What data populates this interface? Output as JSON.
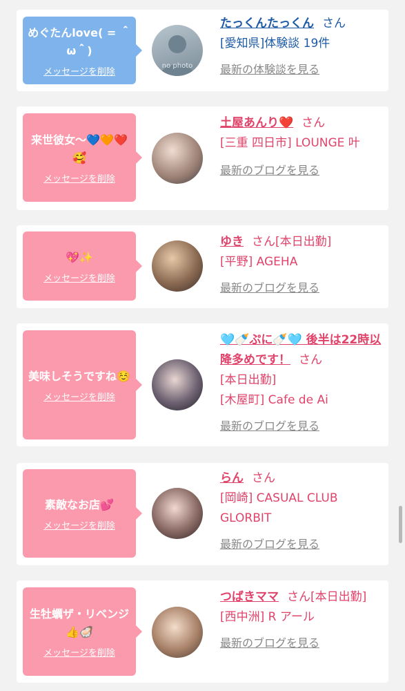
{
  "items": [
    {
      "message": "めぐたんlove( = ＾ω＾)",
      "delete_label": "メッセージを削除",
      "name": "たっくんたっくん",
      "honorific": "さん",
      "details": [
        "[愛知県]体験談 19件"
      ],
      "latest_label": "最新の体験談を見る",
      "avatar_text": "no photo"
    },
    {
      "message": "来世彼女～💙🧡❤️🥰",
      "delete_label": "メッセージを削除",
      "name": "土屋あんり❤️",
      "honorific": "さん",
      "details": [
        "[三重 四日市] LOUNGE 叶"
      ],
      "latest_label": "最新のブログを見る"
    },
    {
      "message": "💖✨",
      "delete_label": "メッセージを削除",
      "name": "ゆき",
      "honorific": "さん[本日出勤]",
      "details": [
        "[平野] AGEHA"
      ],
      "latest_label": "最新のブログを見る"
    },
    {
      "message": "美味しそうですね☺️",
      "delete_label": "メッセージを削除",
      "name": "🩵🍼ぷに🍼🩵 後半は22時以降多めです！",
      "honorific": "さん",
      "details": [
        "[本日出勤]",
        "[木屋町] Cafe de Ai"
      ],
      "latest_label": "最新のブログを見る"
    },
    {
      "message": "素敵なお店💕",
      "delete_label": "メッセージを削除",
      "name": "らん",
      "honorific": "さん",
      "details": [
        "[岡崎] CASUAL CLUB GLORBIT"
      ],
      "latest_label": "最新のブログを見る"
    },
    {
      "message": "生牡蠣ザ・リベンジ👍🦪",
      "delete_label": "メッセージを削除",
      "name": "つばきママ",
      "honorific": "さん[本日出勤]",
      "details": [
        "[西中洲] R アール"
      ],
      "latest_label": "最新のブログを見る"
    }
  ],
  "colors": {
    "blue_bubble": "#7fb3ec",
    "pink_bubble": "#fb9aac",
    "blue_text": "#1d5aa5",
    "pink_text": "#e0436a",
    "muted_text": "#888888",
    "background": "#f2f2f2"
  }
}
